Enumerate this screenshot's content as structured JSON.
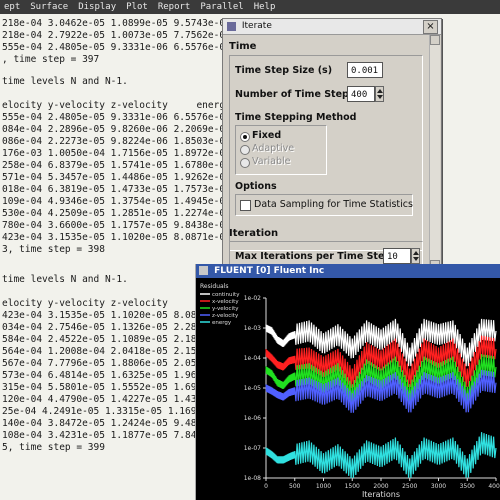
{
  "console": {
    "menu": [
      "ept",
      "Surface",
      "Display",
      "Plot",
      "Report",
      "Parallel",
      "Help"
    ],
    "lines": [
      "218e-04 3.0462e-05 1.0899e-05 9.5743e-08",
      "218e-04 2.7922e-05 1.0073e-05 7.7562e-08",
      "555e-04 2.4805e-05 9.3331e-06 6.5576e-08",
      ", time step = 397",
      "",
      "time levels N and N-1.",
      "",
      "elocity y-velocity z-velocity     energy",
      "555e-04 2.4805e-05 9.3331e-06 6.5576e-08",
      "084e-04 2.2896e-05 9.8260e-06 2.2069e-07",
      "086e-04 2.2273e-05 9.8224e-06 1.8503e-07",
      "176e-03 1.0050e-04 1.7156e-05 1.8972e-07",
      "258e-04 6.8379e-05 1.5741e-05 1.6780e-07",
      "571e-04 5.3457e-05 1.4486e-05 1.9262e-07",
      "018e-04 6.3819e-05 1.4733e-05 1.7573e-07",
      "109e-04 4.9346e-05 1.3754e-05 1.4945e-07",
      "530e-04 4.2509e-05 1.2851e-05 1.2274e-07",
      "780e-04 3.6600e-05 1.1757e-05 9.8438e-08",
      "423e-04 3.1535e-05 1.1020e-05 8.0871e-08",
      "3, time step = 398",
      "",
      "",
      "time levels N and N-1.",
      "",
      "elocity y-velocity z-velocity      en",
      "423e-04 3.1535e-05 1.1020e-05 8.0871",
      "034e-04 2.7546e-05 1.1326e-05 2.2845",
      "584e-04 2.4522e-05 1.1089e-05 2.1829",
      "564e-04 1.2008e-04 2.0418e-05 2.1548",
      "567e-04 7.7796e-05 1.8806e-05 2.0523",
      "573e-04 6.4814e-05 1.6325e-05 1.9627",
      "315e-04 5.5801e-05 1.5552e-05 1.6984",
      "120e-04 4.4790e-05 1.4227e-05 1.4326",
      "25e-04 4.2491e-05 1.3315e-05 1.1699",
      "140e-04 3.8472e-05 1.2424e-05 9.4822",
      "108e-04 3.4231e-05 1.1877e-05 7.8446",
      "5, time step = 399"
    ]
  },
  "iterate": {
    "title": "Iterate",
    "close_glyph": "×",
    "time_section": "Time",
    "time_step_size_label": "Time Step Size (s)",
    "time_step_size_value": "0.001",
    "num_steps_label": "Number of Time Steps",
    "num_steps_value": "400",
    "method_label": "Time Stepping Method",
    "method_fixed": "Fixed",
    "method_adaptive": "Adaptive",
    "method_variable": "Variable",
    "options_label": "Options",
    "data_sampling_label": "Data Sampling for Time Statistics",
    "iteration_label": "Iteration",
    "max_iter_label": "Max Iterations per Time Step",
    "max_iter_value": "10"
  },
  "fluent_window": {
    "title": "FLUENT [0] Fluent Inc"
  },
  "chart_data": {
    "type": "line",
    "title": "",
    "xlabel": "Iterations",
    "ylabel": "",
    "y_scale": "log",
    "xlim": [
      0,
      4000
    ],
    "ylim": [
      1e-08,
      0.01
    ],
    "x_ticks": [
      "0",
      "500",
      "1000",
      "1500",
      "2000",
      "2500",
      "3000",
      "3500",
      "4000"
    ],
    "y_ticks": [
      "1e-02",
      "1e-03",
      "1e-04",
      "1e-05",
      "1e-06",
      "1e-07",
      "1e-08"
    ],
    "grid": false,
    "legend_title": "Residuals",
    "legend_position": "top-left",
    "series": [
      {
        "name": "continuity",
        "color": "#ffffff",
        "x": [
          0,
          100,
          200,
          300,
          400,
          500,
          750,
          1000,
          1250,
          1500,
          1750,
          2000,
          2250,
          2500,
          2750,
          3000,
          3250,
          3500,
          3750,
          4000
        ],
        "y": [
          0.001,
          0.0008,
          0.0004,
          0.0003,
          0.0005,
          0.0006,
          0.0008,
          0.0003,
          0.0006,
          0.0002,
          0.0008,
          0.0004,
          0.0009,
          0.0001,
          0.0009,
          0.0006,
          0.0008,
          0.0001,
          0.0009,
          0.0008
        ]
      },
      {
        "name": "x-velocity",
        "color": "#ff2020",
        "x": [
          0,
          100,
          200,
          300,
          400,
          500,
          750,
          1000,
          1250,
          1500,
          1750,
          2000,
          2250,
          2500,
          2750,
          3000,
          3250,
          3500,
          3750,
          4000
        ],
        "y": [
          0.00015,
          0.0001,
          6e-05,
          5e-05,
          8e-05,
          9e-05,
          0.0001,
          5e-05,
          9e-05,
          2e-05,
          0.00015,
          8e-05,
          0.0002,
          2e-05,
          0.0002,
          0.0001,
          0.0002,
          2e-05,
          0.00025,
          0.0002
        ]
      },
      {
        "name": "y-velocity",
        "color": "#20e020",
        "x": [
          0,
          100,
          200,
          300,
          400,
          500,
          750,
          1000,
          1250,
          1500,
          1750,
          2000,
          2250,
          2500,
          2750,
          3000,
          3250,
          3500,
          3750,
          4000
        ],
        "y": [
          4e-05,
          3e-05,
          1.5e-05,
          1.2e-05,
          2e-05,
          2.5e-05,
          3e-05,
          1.5e-05,
          3e-05,
          6e-06,
          4e-05,
          2e-05,
          5e-05,
          6e-06,
          5e-05,
          3e-05,
          5e-05,
          5e-06,
          6e-05,
          5e-05
        ]
      },
      {
        "name": "z-velocity",
        "color": "#5060ff",
        "x": [
          0,
          100,
          200,
          300,
          400,
          500,
          750,
          1000,
          1250,
          1500,
          1750,
          2000,
          2250,
          2500,
          2750,
          3000,
          3250,
          3500,
          3750,
          4000
        ],
        "y": [
          1e-05,
          8e-06,
          6e-06,
          5e-06,
          7e-06,
          8e-06,
          1e-05,
          6e-06,
          1e-05,
          3e-06,
          1.2e-05,
          8e-06,
          1.5e-05,
          3e-06,
          1.5e-05,
          1e-05,
          1.5e-05,
          3e-06,
          1.8e-05,
          1.5e-05
        ]
      },
      {
        "name": "energy",
        "color": "#30e0e0",
        "x": [
          0,
          100,
          200,
          300,
          400,
          500,
          750,
          1000,
          1250,
          1500,
          1750,
          2000,
          2250,
          2500,
          2750,
          3000,
          3250,
          3500,
          3750,
          4000
        ],
        "y": [
          8e-08,
          6e-08,
          4e-08,
          4e-08,
          5e-08,
          6e-08,
          8e-08,
          3e-08,
          6e-08,
          2e-08,
          8e-08,
          5e-08,
          1e-07,
          2e-08,
          1e-07,
          6e-08,
          1e-07,
          2e-08,
          1.5e-07,
          1e-07
        ]
      }
    ]
  }
}
